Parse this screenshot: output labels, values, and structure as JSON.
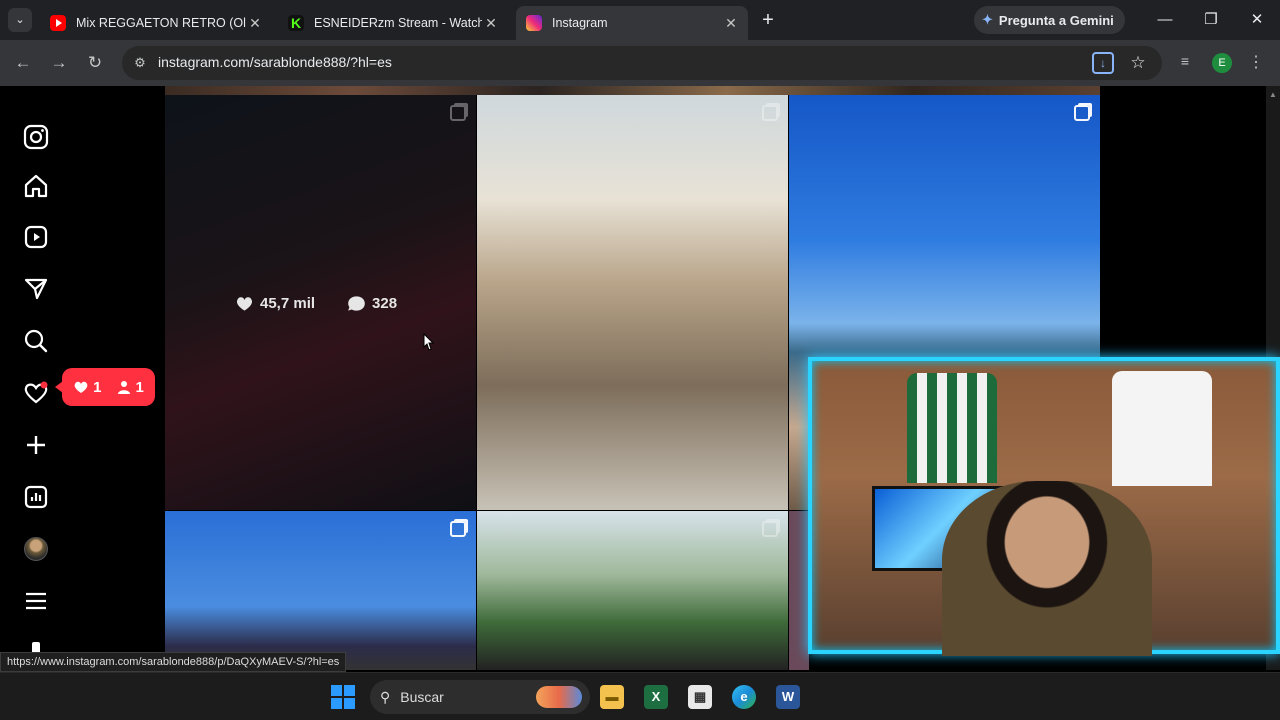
{
  "browser": {
    "tabs": [
      {
        "title": "Mix REGGAETON RETRO (Old S",
        "favicon": "youtube-icon",
        "active": false
      },
      {
        "title": "ESNEIDERzm Stream - Watch Li",
        "favicon": "kick-icon",
        "active": false
      },
      {
        "title": "Instagram",
        "favicon": "instagram-icon",
        "active": true
      }
    ],
    "gemini_label": "Pregunta a Gemini",
    "url": "instagram.com/sarablonde888/?hl=es",
    "profile_initial": "E",
    "status_link": "https://www.instagram.com/sarablonde888/p/DaQXyMAEV-S/?hl=es"
  },
  "instagram": {
    "nav_icons": [
      "instagram-logo-icon",
      "home-icon",
      "reels-icon",
      "messages-icon",
      "search-icon",
      "notifications-icon",
      "create-icon",
      "dashboard-icon",
      "profile-avatar",
      "more-menu-icon"
    ],
    "notification_badge": {
      "likes": "1",
      "followers": "1"
    },
    "hovered_post": {
      "likes": "45,7 mil",
      "comments": "328"
    },
    "colors": {
      "badge": "#ff3040",
      "webcam_border": "#2ad4ff"
    }
  },
  "taskbar": {
    "search_placeholder": "Buscar",
    "apps": [
      "file-explorer-icon",
      "excel-icon",
      "store-icon",
      "edge-icon",
      "word-icon"
    ]
  }
}
